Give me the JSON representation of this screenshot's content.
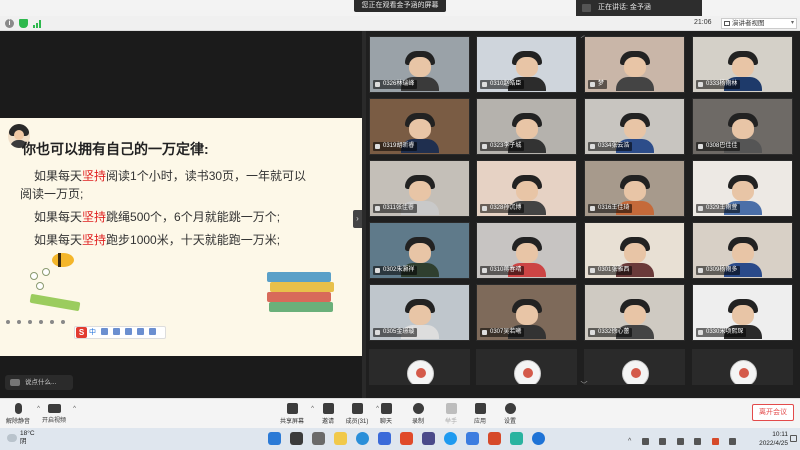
{
  "top": {
    "share_banner": "您正在观看金予涵的屏幕",
    "speaking": "正在讲话: 金予涵"
  },
  "subbar": {
    "clock": "21:06",
    "view_label": "演讲者视图",
    "view_caret": "▾",
    "info_icon": "i"
  },
  "slide": {
    "title": "你也可以拥有自己的一万定律:",
    "line1_pre": "如果每天",
    "line1_kw": "坚持",
    "line1_post": "阅读1个小时，读书30页，一年就可以",
    "line1b": "阅读一万页;",
    "line2_pre": "如果每天",
    "line2_kw": "坚持",
    "line2_post": "跳绳500个，6个月就能跳一万个;",
    "line3_pre": "如果每天",
    "line3_kw": "坚持",
    "line3_post": "跑步1000米，十天就能跑一万米;",
    "ime_logo": "S",
    "ime_text": "中"
  },
  "chat": {
    "placeholder": "说点什么..."
  },
  "colors": {
    "keyword": "#e02020",
    "accent": "#1e6fd9",
    "leave": "#e34a4a"
  },
  "gallery": {
    "tiles": [
      {
        "name": "0326林瑞峰",
        "bg": "#9aa2a8",
        "body": "#3a3a3a"
      },
      {
        "name": "0310赵皓臣",
        "bg": "#cfd5dc",
        "body": "#2c2c2c"
      },
      {
        "name": "梦",
        "bg": "#c9b6a8",
        "body": "#444"
      },
      {
        "name": "0333杨雨林",
        "bg": "#d4d0c8",
        "body": "#1e3a6a"
      },
      {
        "name": "0319胡昕睿",
        "bg": "#7a5c44",
        "body": "#1f2f4f"
      },
      {
        "name": "0323李子城",
        "bg": "#b5b2ad",
        "body": "#333"
      },
      {
        "name": "0334张云浩",
        "bg": "#c8c5c0",
        "body": "#2d4d8a"
      },
      {
        "name": "0308巴佳佳",
        "bg": "#6e6a66",
        "body": "#555"
      },
      {
        "name": "0311张佳睿",
        "bg": "#c4bfb8",
        "body": "#c9c9c9"
      },
      {
        "name": "0328孙沉博",
        "bg": "#e6d2c4",
        "body": "#444"
      },
      {
        "name": "0316王佳琦",
        "bg": "#a79a8c",
        "body": "#c56a3a"
      },
      {
        "name": "0329王雨萱",
        "bg": "#ede9e4",
        "body": "#4b6fa8"
      },
      {
        "name": "0302朱灏祥",
        "bg": "#5f7a8a",
        "body": "#2f3f2f"
      },
      {
        "name": "0310蒋春晴",
        "bg": "#c7c4c2",
        "body": "#c44"
      },
      {
        "name": "0301张雅西",
        "bg": "#e8e0d4",
        "body": "#6a3a3a"
      },
      {
        "name": "0309杨雨多",
        "bg": "#d8d0c6",
        "body": "#2a4a8a"
      },
      {
        "name": "0305金璟璇",
        "bg": "#bfc6cc",
        "body": "#ddd"
      },
      {
        "name": "0307吴若曦",
        "bg": "#7e6a5a",
        "body": "#333"
      },
      {
        "name": "0332徐心蕾",
        "bg": "#cfcac2",
        "body": "#444"
      },
      {
        "name": "0330宋项熙琛",
        "bg": "#eeeeee",
        "body": "#2a2a2a"
      }
    ]
  },
  "toolbar": {
    "mute": "解除静音",
    "video": "开启视频",
    "share": "共享屏幕",
    "invite": "邀请",
    "members": "成员(31)",
    "chat": "聊天",
    "record": "录制",
    "raise": "举手",
    "apps": "应用",
    "settings": "设置",
    "leave": "离开会议",
    "caret": "^"
  },
  "taskbar": {
    "temp": "18°C",
    "weather": "阴",
    "time": "10:11",
    "date": "2022/4/25",
    "ime": "中"
  }
}
